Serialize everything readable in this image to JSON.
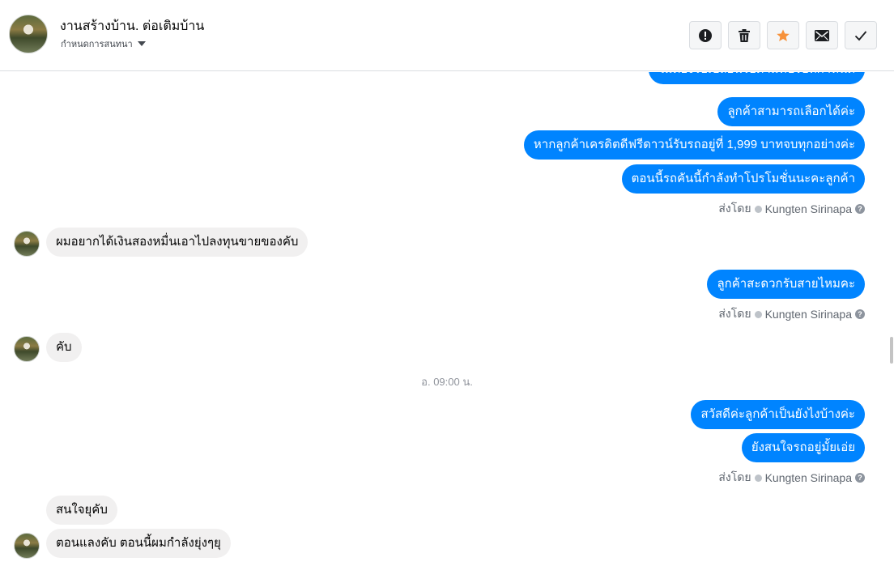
{
  "header": {
    "title": "งานสร้างบ้าน. ต่อเติมบ้าน",
    "subtitle": "กำหนดการสนทนา",
    "buttons": [
      {
        "name": "report-button",
        "icon": "exclamation-circle-icon"
      },
      {
        "name": "delete-button",
        "icon": "trash-icon"
      },
      {
        "name": "star-button",
        "icon": "star-icon",
        "color": "#f7923b"
      },
      {
        "name": "mark-unread-button",
        "icon": "envelope-icon"
      },
      {
        "name": "done-button",
        "icon": "check-icon"
      }
    ]
  },
  "colors": {
    "outgoing": "#0084ff",
    "incoming": "#f1f0f0",
    "accent": "#f7923b"
  },
  "thread": {
    "cut_off_text": "ไม่ต้องไปเปลี่ยนไปตามที่ปรับที่กำหนด",
    "out_group_1": [
      "ลูกค้าสามารถเลือกได้ค่ะ",
      "หากลูกค้าเครดิตดีฟรีดาวน์รับรถอยู่ที่ 1,999 บาทจบทุกอย่างค่ะ",
      "ตอนนี้รถคันนี้กำลังทำโปรโมชั่นนะคะลูกค้า"
    ],
    "sent_by": {
      "prefix": "ส่งโดย",
      "name": "Kungten Sirinapa"
    },
    "in_1": "ผมอยากได้เงินสองหมื่นเอาไปลงทุนขายของคับ",
    "out_2": "ลูกค้าสะดวกรับสายไหมคะ",
    "in_2": "คับ",
    "timestamp": "อ. 09:00 น.",
    "out_group_3": [
      "สวัสดีค่ะลูกค้าเป็นยังไงบ้างค่ะ",
      "ยังสนใจรถอยู่มั้ยเอ่ย"
    ],
    "in_group_3": [
      "สนใจยุคับ",
      "ตอนแลงคับ  ตอนนี้ผมกำลังยุ่งๆยุ"
    ]
  }
}
